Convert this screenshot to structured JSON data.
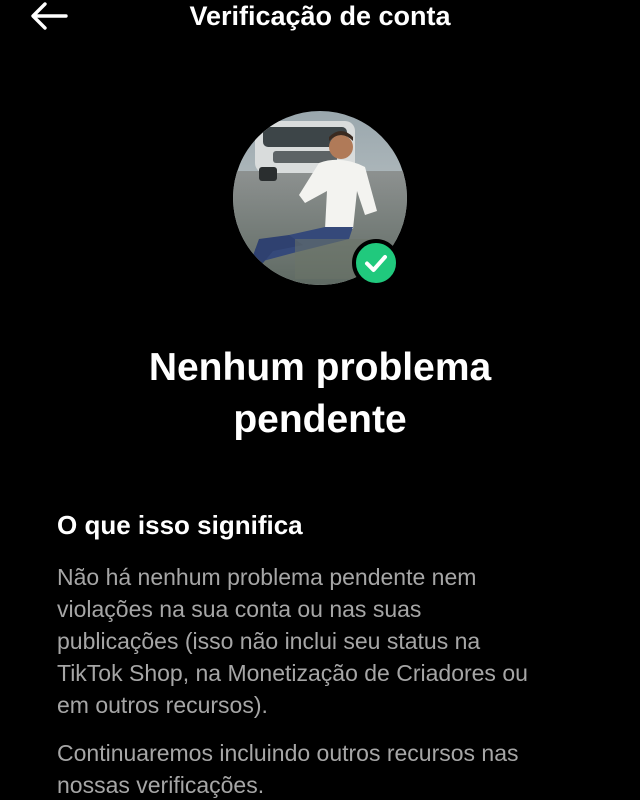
{
  "header": {
    "title": "Verificação de conta",
    "back_icon": "arrow-left-icon"
  },
  "profile": {
    "badge_icon": "checkmark-icon",
    "badge_color": "#20c97d"
  },
  "status": {
    "headline_line1": "Nenhum problema",
    "headline_line2": "pendente"
  },
  "info": {
    "title": "O que isso significa",
    "paragraph1_lines": [
      "Não há nenhum problema pendente nem",
      "violações na sua conta ou nas suas",
      "publicações (isso não inclui seu status na",
      "TikTok Shop, na Monetização de Criadores ou",
      "em outros recursos)."
    ],
    "paragraph2_lines": [
      "Continuaremos incluindo outros recursos nas",
      "nossas verificações."
    ]
  },
  "colors": {
    "background": "#000000",
    "text_primary": "#ffffff",
    "text_secondary": "#a6a6a6"
  }
}
